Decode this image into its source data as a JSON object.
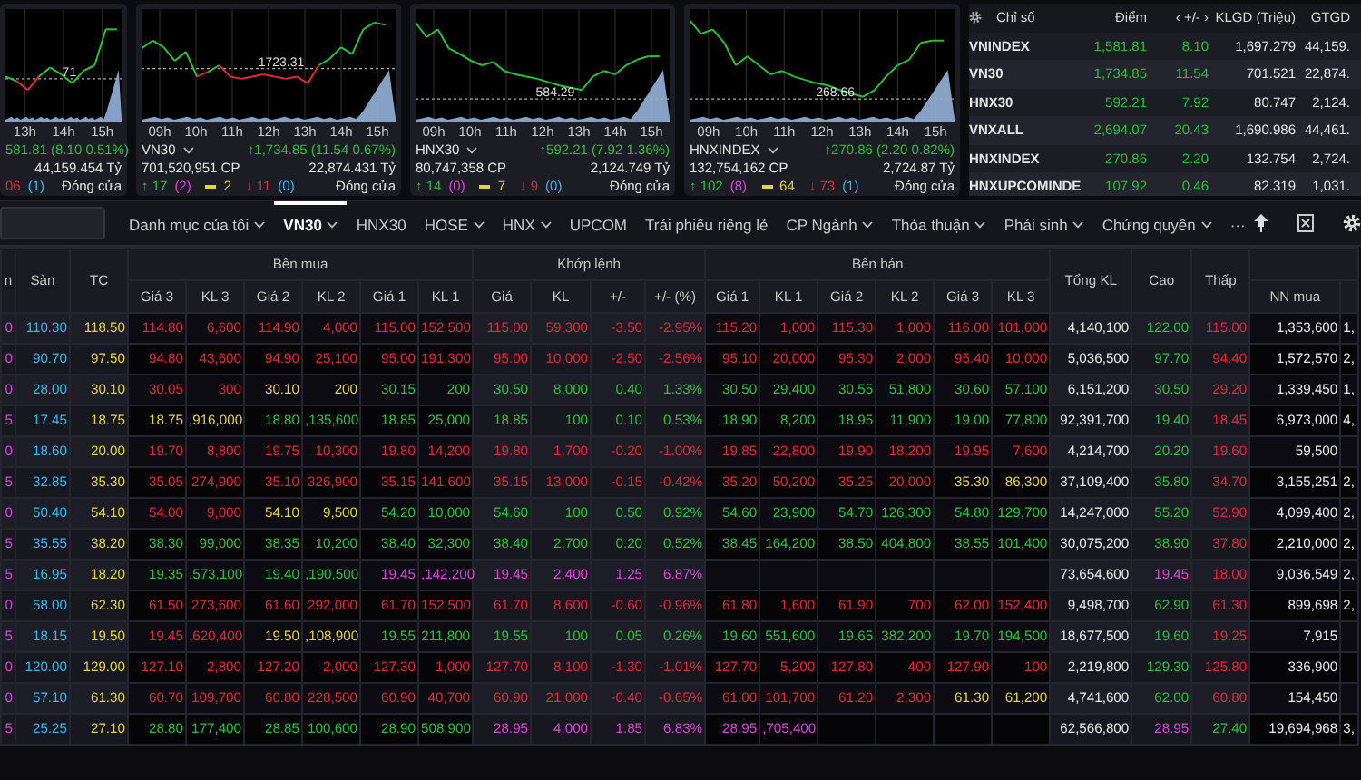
{
  "index_cards": [
    {
      "x_labels": [
        "13h",
        "14h",
        "15h"
      ],
      "ref_label": "71",
      "change": "581.81 (8.10 0.51%)",
      "value": "44,159.454 Tỷ",
      "declines": "06",
      "declines_floor": "(1)",
      "status": "Đóng cửa"
    },
    {
      "name": "VN30",
      "dropdown": true,
      "x_labels": [
        "09h",
        "10h",
        "11h",
        "12h",
        "13h",
        "14h",
        "15h"
      ],
      "ref_label": "1723.31",
      "change": "↑1,734.85 (11.54 0.67%)",
      "volume": "701,520,951 CP",
      "value": "22,874.431 Tỷ",
      "advances": "↑ 17",
      "advances_ceiling": "(2)",
      "unchanged": "2",
      "declines": "↓ 11",
      "declines_floor": "(0)",
      "status": "Đóng cửa"
    },
    {
      "name": "HNX30",
      "dropdown": true,
      "x_labels": [
        "09h",
        "10h",
        "11h",
        "12h",
        "13h",
        "14h",
        "15h"
      ],
      "ref_label": "584.29",
      "change": "↑592.21 (7.92 1.36%)",
      "volume": "80,747,358 CP",
      "value": "2,124.749 Tỷ",
      "advances": "↑ 14",
      "advances_ceiling": "(0)",
      "unchanged": "7",
      "declines": "↓ 9",
      "declines_floor": "(0)",
      "status": "Đóng cửa"
    },
    {
      "name": "HNXINDEX",
      "dropdown": true,
      "x_labels": [
        "09h",
        "10h",
        "11h",
        "12h",
        "13h",
        "14h",
        "15h"
      ],
      "ref_label": "268.66",
      "change": "↑270.86 (2.20 0.82%)",
      "volume": "132,754,162 CP",
      "value": "2,724.87 Tỷ",
      "advances": "↑ 102",
      "advances_ceiling": "(8)",
      "unchanged": "64",
      "declines": "↓ 73",
      "declines_floor": "(1)",
      "status": "Đóng cửa"
    }
  ],
  "indices": {
    "columns": [
      "Chỉ số",
      "Điểm",
      "‹ +/- ›",
      "KLGD (Triệu)",
      "GTGD"
    ],
    "rows": [
      {
        "name": "VNINDEX",
        "points": "1,581.81",
        "change": "8.10",
        "volume": "1,697.279",
        "value": "44,159.",
        "color": "#27c23a"
      },
      {
        "name": "VN30",
        "points": "1,734.85",
        "change": "11.54",
        "volume": "701.521",
        "value": "22,874.",
        "color": "#27c23a"
      },
      {
        "name": "HNX30",
        "points": "592.21",
        "change": "7.92",
        "volume": "80.747",
        "value": "2,124.",
        "color": "#27c23a"
      },
      {
        "name": "VNXALL",
        "points": "2,694.07",
        "change": "20.43",
        "volume": "1,690.986",
        "value": "44,461.",
        "color": "#27c23a"
      },
      {
        "name": "HNXINDEX",
        "points": "270.86",
        "change": "2.20",
        "volume": "132.754",
        "value": "2,724.",
        "color": "#27c23a"
      },
      {
        "name": "HNXUPCOMINDE",
        "points": "107.92",
        "change": "0.46",
        "volume": "82.319",
        "value": "1,031.",
        "color": "#27c23a"
      }
    ]
  },
  "nav": {
    "tabs": [
      {
        "label": "Danh mục của tôi",
        "dropdown": true,
        "selected": false
      },
      {
        "label": "VN30",
        "dropdown": true,
        "selected": true
      },
      {
        "label": "HNX30",
        "dropdown": false,
        "selected": false
      },
      {
        "label": "HOSE",
        "dropdown": true,
        "selected": false
      },
      {
        "label": "HNX",
        "dropdown": true,
        "selected": false
      },
      {
        "label": "UPCOM",
        "dropdown": false,
        "selected": false
      },
      {
        "label": "Trái phiếu riêng lẻ",
        "dropdown": false,
        "selected": false
      },
      {
        "label": "CP Ngành",
        "dropdown": true,
        "selected": false
      },
      {
        "label": "Thỏa thuận",
        "dropdown": true,
        "selected": false
      },
      {
        "label": "Phái sinh",
        "dropdown": true,
        "selected": false
      },
      {
        "label": "Chứng quyền",
        "dropdown": true,
        "selected": false
      },
      {
        "label": "···",
        "dropdown": false,
        "selected": false
      }
    ]
  },
  "board": {
    "column_1": "n",
    "fixed_columns": [
      "Sàn",
      "TC"
    ],
    "groups": [
      "Bên mua",
      "Khớp lệnh",
      "Bên bán"
    ],
    "sub_columns": [
      "Giá 3",
      "KL 3",
      "Giá 2",
      "KL 2",
      "Giá 1",
      "KL 1",
      "Giá",
      "KL",
      "+/-",
      "+/- (%)",
      "Giá 1",
      "KL 1",
      "Giá 2",
      "KL 2",
      "Giá 3",
      "KL 3"
    ],
    "totals": [
      "Tổng KL",
      "Cao",
      "Thấp"
    ],
    "foreign": [
      "NN mua"
    ],
    "rows": [
      {
        "ceiling": {
          "text": "0",
          "color": "#d845d8"
        },
        "floor": {
          "text": "110.30",
          "color": "#36b8ee"
        },
        "reference": {
          "text": "118.50",
          "color": "#e3d43a"
        },
        "buy": [
          {
            "text": "114.80",
            "color": "#e02a3c"
          },
          {
            "text": "6,600",
            "color": "#e02a3c"
          },
          {
            "text": "114.90",
            "color": "#e02a3c"
          },
          {
            "text": "4,000",
            "color": "#e02a3c"
          },
          {
            "text": "115.00",
            "color": "#e02a3c"
          },
          {
            "text": "152,500",
            "color": "#e02a3c"
          }
        ],
        "match": [
          {
            "text": "115.00",
            "color": "#e02a3c"
          },
          {
            "text": "59,300",
            "color": "#e02a3c"
          },
          {
            "text": "-3.50",
            "color": "#e02a3c"
          },
          {
            "text": "-2.95%",
            "color": "#e02a3c"
          }
        ],
        "sell": [
          {
            "text": "115.20",
            "color": "#e02a3c"
          },
          {
            "text": "1,000",
            "color": "#e02a3c"
          },
          {
            "text": "115.30",
            "color": "#e02a3c"
          },
          {
            "text": "1,000",
            "color": "#e02a3c"
          },
          {
            "text": "116.00",
            "color": "#e02a3c"
          },
          {
            "text": "101,000",
            "color": "#e02a3c"
          }
        ],
        "totals": [
          {
            "text": "4,140,100"
          },
          {
            "text": "122.00",
            "color": "#27c23a"
          },
          {
            "text": "115.00",
            "color": "#e02a3c"
          }
        ],
        "foreign": [
          {
            "text": "1,353,600"
          },
          {
            "text": "1,"
          }
        ]
      },
      {
        "ceiling": {
          "text": "0",
          "color": "#d845d8"
        },
        "floor": {
          "text": "90.70",
          "color": "#36b8ee"
        },
        "reference": {
          "text": "97.50",
          "color": "#e3d43a"
        },
        "buy": [
          {
            "text": "94.80",
            "color": "#e02a3c"
          },
          {
            "text": "43,600",
            "color": "#e02a3c"
          },
          {
            "text": "94.90",
            "color": "#e02a3c"
          },
          {
            "text": "25,100",
            "color": "#e02a3c"
          },
          {
            "text": "95.00",
            "color": "#e02a3c"
          },
          {
            "text": "191,300",
            "color": "#e02a3c"
          }
        ],
        "match": [
          {
            "text": "95.00",
            "color": "#e02a3c"
          },
          {
            "text": "10,000",
            "color": "#e02a3c"
          },
          {
            "text": "-2.50",
            "color": "#e02a3c"
          },
          {
            "text": "-2.56%",
            "color": "#e02a3c"
          }
        ],
        "sell": [
          {
            "text": "95.10",
            "color": "#e02a3c"
          },
          {
            "text": "20,000",
            "color": "#e02a3c"
          },
          {
            "text": "95.30",
            "color": "#e02a3c"
          },
          {
            "text": "2,000",
            "color": "#e02a3c"
          },
          {
            "text": "95.40",
            "color": "#e02a3c"
          },
          {
            "text": "10,000",
            "color": "#e02a3c"
          }
        ],
        "totals": [
          {
            "text": "5,036,500"
          },
          {
            "text": "97.70",
            "color": "#27c23a"
          },
          {
            "text": "94.40",
            "color": "#e02a3c"
          }
        ],
        "foreign": [
          {
            "text": "1,572,570"
          },
          {
            "text": "2,"
          }
        ]
      },
      {
        "ceiling": {
          "text": "0",
          "color": "#d845d8"
        },
        "floor": {
          "text": "28.00",
          "color": "#36b8ee"
        },
        "reference": {
          "text": "30.10",
          "color": "#e3d43a"
        },
        "buy": [
          {
            "text": "30.05",
            "color": "#e02a3c"
          },
          {
            "text": "300",
            "color": "#e02a3c"
          },
          {
            "text": "30.10",
            "color": "#e3d43a"
          },
          {
            "text": "200",
            "color": "#e3d43a"
          },
          {
            "text": "30.15",
            "color": "#27c23a"
          },
          {
            "text": "200",
            "color": "#27c23a"
          }
        ],
        "match": [
          {
            "text": "30.50",
            "color": "#27c23a"
          },
          {
            "text": "8,000",
            "color": "#27c23a"
          },
          {
            "text": "0.40",
            "color": "#27c23a"
          },
          {
            "text": "1.33%",
            "color": "#27c23a"
          }
        ],
        "sell": [
          {
            "text": "30.50",
            "color": "#27c23a"
          },
          {
            "text": "29,400",
            "color": "#27c23a"
          },
          {
            "text": "30.55",
            "color": "#27c23a"
          },
          {
            "text": "51,800",
            "color": "#27c23a"
          },
          {
            "text": "30.60",
            "color": "#27c23a"
          },
          {
            "text": "57,100",
            "color": "#27c23a"
          }
        ],
        "totals": [
          {
            "text": "6,151,200"
          },
          {
            "text": "30.50",
            "color": "#27c23a"
          },
          {
            "text": "29.20",
            "color": "#e02a3c"
          }
        ],
        "foreign": [
          {
            "text": "1,339,450"
          },
          {
            "text": "1,"
          }
        ]
      },
      {
        "ceiling": {
          "text": "5",
          "color": "#d845d8"
        },
        "floor": {
          "text": "17.45",
          "color": "#36b8ee"
        },
        "reference": {
          "text": "18.75",
          "color": "#e3d43a"
        },
        "buy": [
          {
            "text": "18.75",
            "color": "#e3d43a"
          },
          {
            "text": ",916,000",
            "color": "#e3d43a"
          },
          {
            "text": "18.80",
            "color": "#27c23a"
          },
          {
            "text": ",135,600",
            "color": "#27c23a"
          },
          {
            "text": "18.85",
            "color": "#27c23a"
          },
          {
            "text": "25,000",
            "color": "#27c23a"
          }
        ],
        "match": [
          {
            "text": "18.85",
            "color": "#27c23a"
          },
          {
            "text": "100",
            "color": "#27c23a"
          },
          {
            "text": "0.10",
            "color": "#27c23a"
          },
          {
            "text": "0.53%",
            "color": "#27c23a"
          }
        ],
        "sell": [
          {
            "text": "18.90",
            "color": "#27c23a"
          },
          {
            "text": "8,200",
            "color": "#27c23a"
          },
          {
            "text": "18.95",
            "color": "#27c23a"
          },
          {
            "text": "11,900",
            "color": "#27c23a"
          },
          {
            "text": "19.00",
            "color": "#27c23a"
          },
          {
            "text": "77,800",
            "color": "#27c23a"
          }
        ],
        "totals": [
          {
            "text": "92,391,700"
          },
          {
            "text": "19.40",
            "color": "#27c23a"
          },
          {
            "text": "18.45",
            "color": "#e02a3c"
          }
        ],
        "foreign": [
          {
            "text": "6,973,000"
          },
          {
            "text": "4,"
          }
        ]
      },
      {
        "ceiling": {
          "text": "0",
          "color": "#d845d8"
        },
        "floor": {
          "text": "18.60",
          "color": "#36b8ee"
        },
        "reference": {
          "text": "20.00",
          "color": "#e3d43a"
        },
        "buy": [
          {
            "text": "19.70",
            "color": "#e02a3c"
          },
          {
            "text": "8,800",
            "color": "#e02a3c"
          },
          {
            "text": "19.75",
            "color": "#e02a3c"
          },
          {
            "text": "10,300",
            "color": "#e02a3c"
          },
          {
            "text": "19.80",
            "color": "#e02a3c"
          },
          {
            "text": "14,200",
            "color": "#e02a3c"
          }
        ],
        "match": [
          {
            "text": "19.80",
            "color": "#e02a3c"
          },
          {
            "text": "1,700",
            "color": "#e02a3c"
          },
          {
            "text": "-0.20",
            "color": "#e02a3c"
          },
          {
            "text": "-1.00%",
            "color": "#e02a3c"
          }
        ],
        "sell": [
          {
            "text": "19.85",
            "color": "#e02a3c"
          },
          {
            "text": "22,800",
            "color": "#e02a3c"
          },
          {
            "text": "19.90",
            "color": "#e02a3c"
          },
          {
            "text": "18,200",
            "color": "#e02a3c"
          },
          {
            "text": "19.95",
            "color": "#e02a3c"
          },
          {
            "text": "7,600",
            "color": "#e02a3c"
          }
        ],
        "totals": [
          {
            "text": "4,214,700"
          },
          {
            "text": "20.20",
            "color": "#27c23a"
          },
          {
            "text": "19.60",
            "color": "#e02a3c"
          }
        ],
        "foreign": [
          {
            "text": "59,500"
          }
        ]
      },
      {
        "ceiling": {
          "text": "5",
          "color": "#d845d8"
        },
        "floor": {
          "text": "32.85",
          "color": "#36b8ee"
        },
        "reference": {
          "text": "35.30",
          "color": "#e3d43a"
        },
        "buy": [
          {
            "text": "35.05",
            "color": "#e02a3c"
          },
          {
            "text": "274,900",
            "color": "#e02a3c"
          },
          {
            "text": "35.10",
            "color": "#e02a3c"
          },
          {
            "text": "326,900",
            "color": "#e02a3c"
          },
          {
            "text": "35.15",
            "color": "#e02a3c"
          },
          {
            "text": "141,600",
            "color": "#e02a3c"
          }
        ],
        "match": [
          {
            "text": "35.15",
            "color": "#e02a3c"
          },
          {
            "text": "13,000",
            "color": "#e02a3c"
          },
          {
            "text": "-0.15",
            "color": "#e02a3c"
          },
          {
            "text": "-0.42%",
            "color": "#e02a3c"
          }
        ],
        "sell": [
          {
            "text": "35.20",
            "color": "#e02a3c"
          },
          {
            "text": "50,200",
            "color": "#e02a3c"
          },
          {
            "text": "35.25",
            "color": "#e02a3c"
          },
          {
            "text": "20,000",
            "color": "#e02a3c"
          },
          {
            "text": "35.30",
            "color": "#e3d43a"
          },
          {
            "text": "86,300",
            "color": "#e3d43a"
          }
        ],
        "totals": [
          {
            "text": "37,109,400"
          },
          {
            "text": "35.80",
            "color": "#27c23a"
          },
          {
            "text": "34.70",
            "color": "#e02a3c"
          }
        ],
        "foreign": [
          {
            "text": "3,155,251"
          },
          {
            "text": "2,"
          }
        ]
      },
      {
        "ceiling": {
          "text": "0",
          "color": "#d845d8"
        },
        "floor": {
          "text": "50.40",
          "color": "#36b8ee"
        },
        "reference": {
          "text": "54.10",
          "color": "#e3d43a"
        },
        "buy": [
          {
            "text": "54.00",
            "color": "#e02a3c"
          },
          {
            "text": "9,000",
            "color": "#e02a3c"
          },
          {
            "text": "54.10",
            "color": "#e3d43a"
          },
          {
            "text": "9,500",
            "color": "#e3d43a"
          },
          {
            "text": "54.20",
            "color": "#27c23a"
          },
          {
            "text": "10,000",
            "color": "#27c23a"
          }
        ],
        "match": [
          {
            "text": "54.60",
            "color": "#27c23a"
          },
          {
            "text": "100",
            "color": "#27c23a"
          },
          {
            "text": "0.50",
            "color": "#27c23a"
          },
          {
            "text": "0.92%",
            "color": "#27c23a"
          }
        ],
        "sell": [
          {
            "text": "54.60",
            "color": "#27c23a"
          },
          {
            "text": "23,900",
            "color": "#27c23a"
          },
          {
            "text": "54.70",
            "color": "#27c23a"
          },
          {
            "text": "126,300",
            "color": "#27c23a"
          },
          {
            "text": "54.80",
            "color": "#27c23a"
          },
          {
            "text": "129,700",
            "color": "#27c23a"
          }
        ],
        "totals": [
          {
            "text": "14,247,000"
          },
          {
            "text": "55.20",
            "color": "#27c23a"
          },
          {
            "text": "52.90",
            "color": "#e02a3c"
          }
        ],
        "foreign": [
          {
            "text": "4,099,400"
          },
          {
            "text": "2,"
          }
        ]
      },
      {
        "ceiling": {
          "text": "5",
          "color": "#d845d8"
        },
        "floor": {
          "text": "35.55",
          "color": "#36b8ee"
        },
        "reference": {
          "text": "38.20",
          "color": "#e3d43a"
        },
        "buy": [
          {
            "text": "38.30",
            "color": "#27c23a"
          },
          {
            "text": "99,000",
            "color": "#27c23a"
          },
          {
            "text": "38.35",
            "color": "#27c23a"
          },
          {
            "text": "10,200",
            "color": "#27c23a"
          },
          {
            "text": "38.40",
            "color": "#27c23a"
          },
          {
            "text": "32,300",
            "color": "#27c23a"
          }
        ],
        "match": [
          {
            "text": "38.40",
            "color": "#27c23a"
          },
          {
            "text": "2,700",
            "color": "#27c23a"
          },
          {
            "text": "0.20",
            "color": "#27c23a"
          },
          {
            "text": "0.52%",
            "color": "#27c23a"
          }
        ],
        "sell": [
          {
            "text": "38.45",
            "color": "#27c23a"
          },
          {
            "text": "164,200",
            "color": "#27c23a"
          },
          {
            "text": "38.50",
            "color": "#27c23a"
          },
          {
            "text": "404,800",
            "color": "#27c23a"
          },
          {
            "text": "38.55",
            "color": "#27c23a"
          },
          {
            "text": "101,400",
            "color": "#27c23a"
          }
        ],
        "totals": [
          {
            "text": "30,075,200"
          },
          {
            "text": "38.90",
            "color": "#27c23a"
          },
          {
            "text": "37.80",
            "color": "#e02a3c"
          }
        ],
        "foreign": [
          {
            "text": "2,210,000"
          },
          {
            "text": "2,"
          }
        ]
      },
      {
        "ceiling": {
          "text": "5",
          "color": "#d845d8"
        },
        "floor": {
          "text": "16.95",
          "color": "#36b8ee"
        },
        "reference": {
          "text": "18.20",
          "color": "#e3d43a"
        },
        "buy": [
          {
            "text": "19.35",
            "color": "#27c23a"
          },
          {
            "text": ",573,100",
            "color": "#27c23a"
          },
          {
            "text": "19.40",
            "color": "#27c23a"
          },
          {
            "text": ",190,500",
            "color": "#27c23a"
          },
          {
            "text": "19.45",
            "color": "#d845d8"
          },
          {
            "text": ",142,200",
            "color": "#d845d8"
          }
        ],
        "match": [
          {
            "text": "19.45",
            "color": "#d845d8"
          },
          {
            "text": "2,400",
            "color": "#d845d8"
          },
          {
            "text": "1.25",
            "color": "#d845d8"
          },
          {
            "text": "6.87%",
            "color": "#d845d8"
          }
        ],
        "totals": [
          {
            "text": "73,654,600"
          },
          {
            "text": "19.45",
            "color": "#d845d8"
          },
          {
            "text": "18.00",
            "color": "#e02a3c"
          }
        ],
        "foreign": [
          {
            "text": "9,036,549"
          },
          {
            "text": "2,"
          }
        ]
      },
      {
        "ceiling": {
          "text": "0",
          "color": "#d845d8"
        },
        "floor": {
          "text": "58.00",
          "color": "#36b8ee"
        },
        "reference": {
          "text": "62.30",
          "color": "#e3d43a"
        },
        "buy": [
          {
            "text": "61.50",
            "color": "#e02a3c"
          },
          {
            "text": "273,600",
            "color": "#e02a3c"
          },
          {
            "text": "61.60",
            "color": "#e02a3c"
          },
          {
            "text": "292,000",
            "color": "#e02a3c"
          },
          {
            "text": "61.70",
            "color": "#e02a3c"
          },
          {
            "text": "152,500",
            "color": "#e02a3c"
          }
        ],
        "match": [
          {
            "text": "61.70",
            "color": "#e02a3c"
          },
          {
            "text": "8,600",
            "color": "#e02a3c"
          },
          {
            "text": "-0.60",
            "color": "#e02a3c"
          },
          {
            "text": "-0.96%",
            "color": "#e02a3c"
          }
        ],
        "sell": [
          {
            "text": "61.80",
            "color": "#e02a3c"
          },
          {
            "text": "1,600",
            "color": "#e02a3c"
          },
          {
            "text": "61.90",
            "color": "#e02a3c"
          },
          {
            "text": "700",
            "color": "#e02a3c"
          },
          {
            "text": "62.00",
            "color": "#e02a3c"
          },
          {
            "text": "152,400",
            "color": "#e02a3c"
          }
        ],
        "totals": [
          {
            "text": "9,498,700"
          },
          {
            "text": "62.90",
            "color": "#27c23a"
          },
          {
            "text": "61.30",
            "color": "#e02a3c"
          }
        ],
        "foreign": [
          {
            "text": "899,698"
          },
          {
            "text": "2,"
          }
        ]
      },
      {
        "ceiling": {
          "text": "5",
          "color": "#d845d8"
        },
        "floor": {
          "text": "18.15",
          "color": "#36b8ee"
        },
        "reference": {
          "text": "19.50",
          "color": "#e3d43a"
        },
        "buy": [
          {
            "text": "19.45",
            "color": "#e02a3c"
          },
          {
            "text": ",620,400",
            "color": "#e02a3c"
          },
          {
            "text": "19.50",
            "color": "#e3d43a"
          },
          {
            "text": ",108,900",
            "color": "#e3d43a"
          },
          {
            "text": "19.55",
            "color": "#27c23a"
          },
          {
            "text": "211,800",
            "color": "#27c23a"
          }
        ],
        "match": [
          {
            "text": "19.55",
            "color": "#27c23a"
          },
          {
            "text": "100",
            "color": "#27c23a"
          },
          {
            "text": "0.05",
            "color": "#27c23a"
          },
          {
            "text": "0.26%",
            "color": "#27c23a"
          }
        ],
        "sell": [
          {
            "text": "19.60",
            "color": "#27c23a"
          },
          {
            "text": "551,600",
            "color": "#27c23a"
          },
          {
            "text": "19.65",
            "color": "#27c23a"
          },
          {
            "text": "382,200",
            "color": "#27c23a"
          },
          {
            "text": "19.70",
            "color": "#27c23a"
          },
          {
            "text": "194,500",
            "color": "#27c23a"
          }
        ],
        "totals": [
          {
            "text": "18,677,500"
          },
          {
            "text": "19.60",
            "color": "#27c23a"
          },
          {
            "text": "19.25",
            "color": "#e02a3c"
          }
        ],
        "foreign": [
          {
            "text": "7,915"
          }
        ]
      },
      {
        "ceiling": {
          "text": "0",
          "color": "#d845d8"
        },
        "floor": {
          "text": "120.00",
          "color": "#36b8ee"
        },
        "reference": {
          "text": "129.00",
          "color": "#e3d43a"
        },
        "buy": [
          {
            "text": "127.10",
            "color": "#e02a3c"
          },
          {
            "text": "2,800",
            "color": "#e02a3c"
          },
          {
            "text": "127.20",
            "color": "#e02a3c"
          },
          {
            "text": "2,000",
            "color": "#e02a3c"
          },
          {
            "text": "127.30",
            "color": "#e02a3c"
          },
          {
            "text": "1,000",
            "color": "#e02a3c"
          }
        ],
        "match": [
          {
            "text": "127.70",
            "color": "#e02a3c"
          },
          {
            "text": "8,100",
            "color": "#e02a3c"
          },
          {
            "text": "-1.30",
            "color": "#e02a3c"
          },
          {
            "text": "-1.01%",
            "color": "#e02a3c"
          }
        ],
        "sell": [
          {
            "text": "127.70",
            "color": "#e02a3c"
          },
          {
            "text": "5,200",
            "color": "#e02a3c"
          },
          {
            "text": "127.80",
            "color": "#e02a3c"
          },
          {
            "text": "400",
            "color": "#e02a3c"
          },
          {
            "text": "127.90",
            "color": "#e02a3c"
          },
          {
            "text": "100",
            "color": "#e02a3c"
          }
        ],
        "totals": [
          {
            "text": "2,219,800"
          },
          {
            "text": "129.30",
            "color": "#27c23a"
          },
          {
            "text": "125.80",
            "color": "#e02a3c"
          }
        ],
        "foreign": [
          {
            "text": "336,900"
          }
        ]
      },
      {
        "ceiling": {
          "text": "0",
          "color": "#d845d8"
        },
        "floor": {
          "text": "57.10",
          "color": "#36b8ee"
        },
        "reference": {
          "text": "61.30",
          "color": "#e3d43a"
        },
        "buy": [
          {
            "text": "60.70",
            "color": "#e02a3c"
          },
          {
            "text": "109,700",
            "color": "#e02a3c"
          },
          {
            "text": "60.80",
            "color": "#e02a3c"
          },
          {
            "text": "228,500",
            "color": "#e02a3c"
          },
          {
            "text": "60.90",
            "color": "#e02a3c"
          },
          {
            "text": "40,700",
            "color": "#e02a3c"
          }
        ],
        "match": [
          {
            "text": "60.90",
            "color": "#e02a3c"
          },
          {
            "text": "21,000",
            "color": "#e02a3c"
          },
          {
            "text": "-0.40",
            "color": "#e02a3c"
          },
          {
            "text": "-0.65%",
            "color": "#e02a3c"
          }
        ],
        "sell": [
          {
            "text": "61.00",
            "color": "#e02a3c"
          },
          {
            "text": "101,700",
            "color": "#e02a3c"
          },
          {
            "text": "61.20",
            "color": "#e02a3c"
          },
          {
            "text": "2,300",
            "color": "#e02a3c"
          },
          {
            "text": "61.30",
            "color": "#e3d43a"
          },
          {
            "text": "61,200",
            "color": "#e3d43a"
          }
        ],
        "totals": [
          {
            "text": "4,741,600"
          },
          {
            "text": "62.00",
            "color": "#27c23a"
          },
          {
            "text": "60.80",
            "color": "#e02a3c"
          }
        ],
        "foreign": [
          {
            "text": "154,450"
          }
        ]
      },
      {
        "ceiling": {
          "text": "5",
          "color": "#d845d8"
        },
        "floor": {
          "text": "25.25",
          "color": "#36b8ee"
        },
        "reference": {
          "text": "27.10",
          "color": "#e3d43a"
        },
        "buy": [
          {
            "text": "28.80",
            "color": "#27c23a"
          },
          {
            "text": "177,400",
            "color": "#27c23a"
          },
          {
            "text": "28.85",
            "color": "#27c23a"
          },
          {
            "text": "100,600",
            "color": "#27c23a"
          },
          {
            "text": "28.90",
            "color": "#27c23a"
          },
          {
            "text": "508,900",
            "color": "#27c23a"
          }
        ],
        "match": [
          {
            "text": "28.95",
            "color": "#d845d8"
          },
          {
            "text": "4,000",
            "color": "#d845d8"
          },
          {
            "text": "1.85",
            "color": "#d845d8"
          },
          {
            "text": "6.83%",
            "color": "#d845d8"
          }
        ],
        "sell": [
          {
            "text": "28.95",
            "color": "#d845d8"
          },
          {
            "text": ",705,400",
            "color": "#d845d8"
          }
        ],
        "totals": [
          {
            "text": "62,566,800"
          },
          {
            "text": "28.95",
            "color": "#d845d8"
          },
          {
            "text": "27.40",
            "color": "#27c23a"
          }
        ],
        "foreign": [
          {
            "text": "19,694,968"
          },
          {
            "text": "3,"
          }
        ]
      }
    ]
  }
}
